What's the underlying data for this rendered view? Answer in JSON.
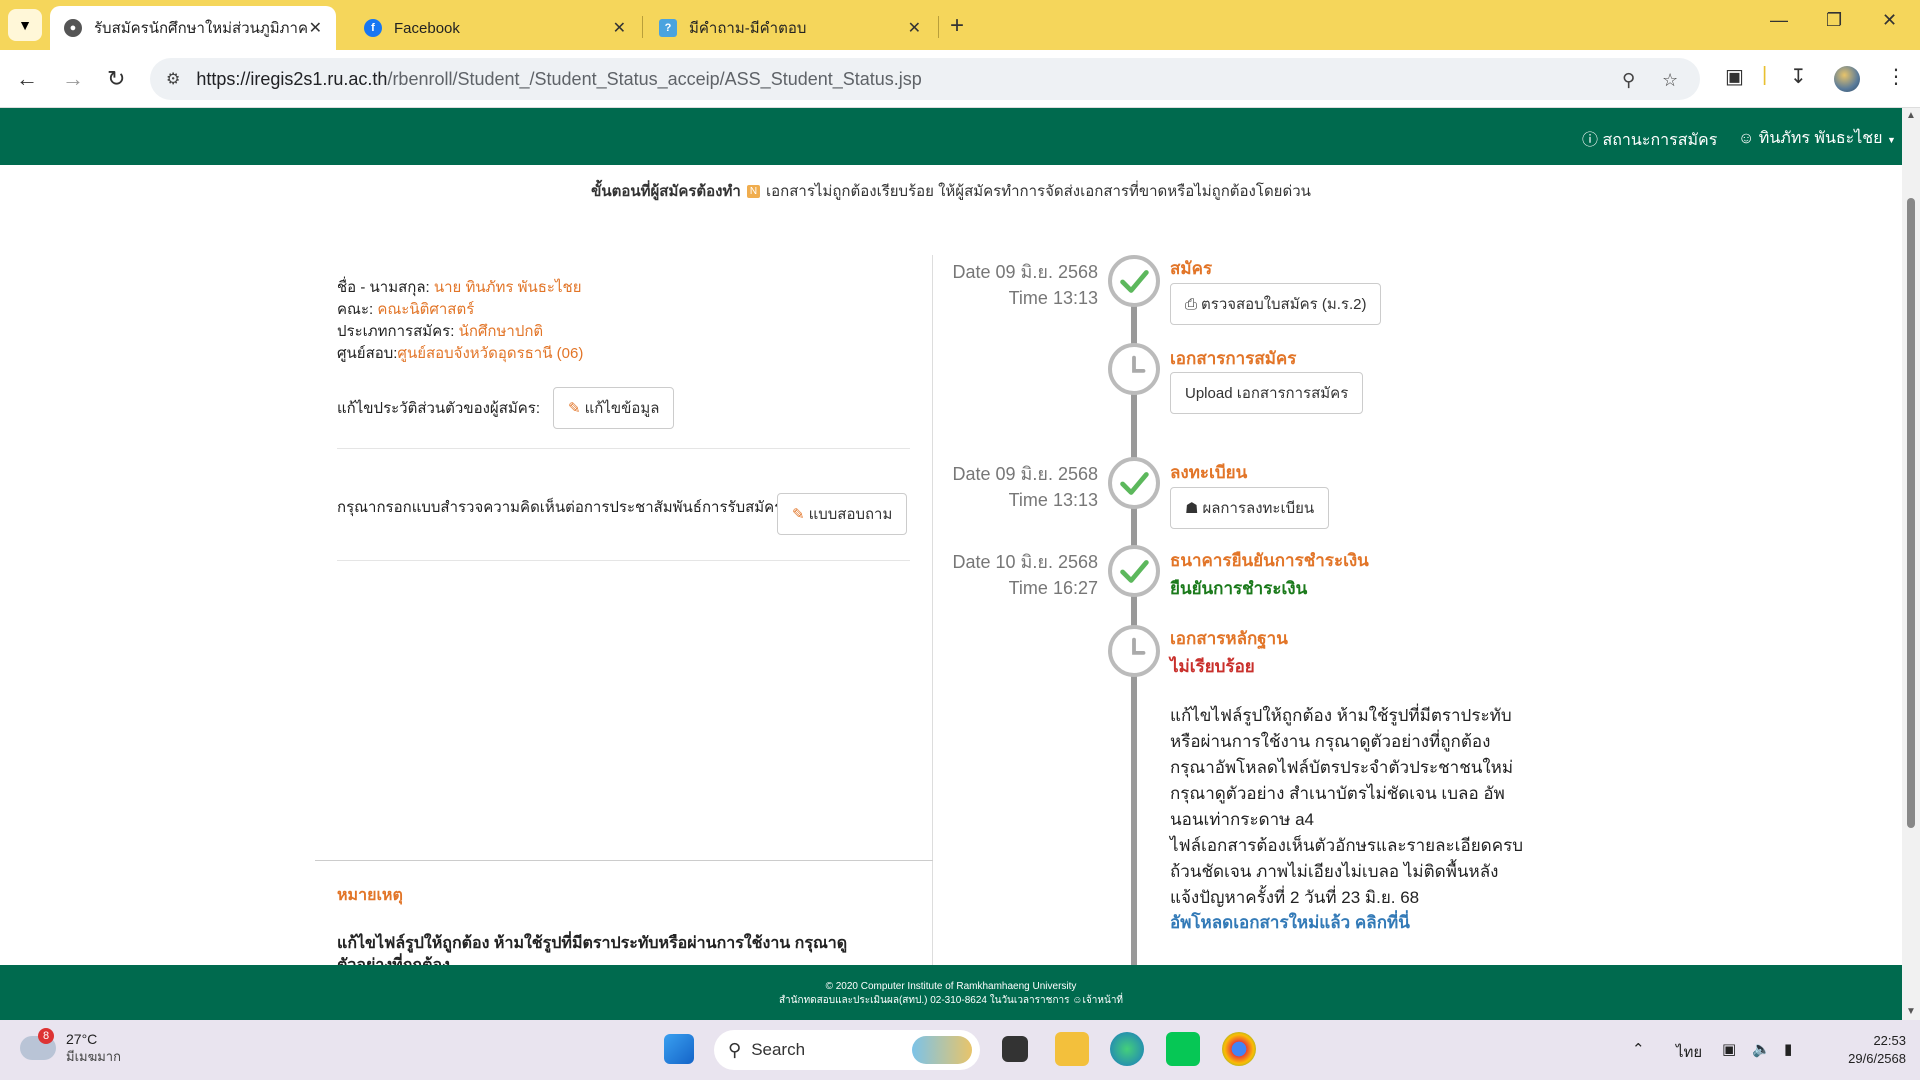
{
  "browser": {
    "tabs": [
      {
        "title": "รับสมัครนักศึกษาใหม่ส่วนภูมิภาค",
        "active": true
      },
      {
        "title": "Facebook",
        "active": false
      },
      {
        "title": "มีคำถาม-มีคำตอบ",
        "active": false
      }
    ],
    "url_host": "https://iregis2s1.ru.ac.th",
    "url_path": "/rbenroll/Student_/Student_Status_acceip/ASS_Student_Status.jsp"
  },
  "nav": {
    "status_label": "สถานะการสมัคร",
    "user_label": "ทินภัทร พันธะไชย"
  },
  "notice": {
    "lead": "ขั้นตอนที่ผู้สมัครต้องทำ",
    "badge": "N",
    "text": "เอกสารไม่ถูกต้องเรียบร้อย ให้ผู้สมัครทำการจัดส่งเอกสารที่ขาดหรือไม่ถูกต้องโดยด่วน"
  },
  "applicant": {
    "name_label": "ชื่อ - นามสกุล:",
    "name_value": "นาย ทินภัทร พันธะไชย",
    "faculty_label": "คณะ:",
    "faculty_value": "คณะนิติศาสตร์",
    "type_label": "ประเภทการสมัคร:",
    "type_value": "นักศึกษาปกติ",
    "center_label": "ศูนย์สอบ:",
    "center_value": "ศูนย์สอบจังหวัดอุดรธานี (06)",
    "edit_label": "แก้ไขประวัติส่วนตัวของผู้สมัคร:",
    "edit_button": "แก้ไขข้อมูล",
    "survey_label": "กรุณากรอกแบบสำรวจความคิดเห็นต่อการประชาสัมพันธ์การรับสมัคร",
    "survey_button": "แบบสอบถาม"
  },
  "remark": {
    "title": "หมายเหตุ",
    "body": "แก้ไขไฟล์รูปให้ถูกต้อง ห้ามใช้รูปที่มีตราประทับหรือผ่านการใช้งาน กรุณาดูตัวอย่างที่ถูกต้อง"
  },
  "timeline": {
    "apply": {
      "date": "Date 09 มิ.ย. 2568",
      "time": "Time 13:13",
      "title": "สมัคร",
      "button": "ตรวจสอบใบสมัคร (ม.ร.2)",
      "status": "done"
    },
    "docs": {
      "title": "เอกสารการสมัคร",
      "button": "Upload เอกสารการสมัคร",
      "status": "pending"
    },
    "register": {
      "date": "Date 09 มิ.ย. 2568",
      "time": "Time 13:13",
      "title": "ลงทะเบียน",
      "button": "ผลการลงทะเบียน",
      "status": "done"
    },
    "payment": {
      "date": "Date 10 มิ.ย. 2568",
      "time": "Time 16:27",
      "title": "ธนาคารยืนยันการชำระเงิน",
      "state": "ยืนยันการชำระเงิน",
      "status": "done"
    },
    "evidence": {
      "title": "เอกสารหลักฐาน",
      "state": "ไม่เรียบร้อย",
      "status": "pending",
      "desc_lines": [
        "แก้ไขไฟล์รูปให้ถูกต้อง ห้ามใช้รูปที่มีตราประทับ",
        "หรือผ่านการใช้งาน กรุณาดูตัวอย่างที่ถูกต้อง",
        "กรุณาอัพโหลดไฟล์บัตรประจำตัวประชาชนใหม่",
        "กรุณาดูตัวอย่าง สำเนาบัตรไม่ชัดเจน เบลอ อัพ",
        "นอนเท่ากระดาษ a4",
        "ไฟล์เอกสารต้องเห็นตัวอักษรและรายละเอียดครบ",
        "ถ้วนชัดเจน ภาพไม่เอียงไม่เบลอ ไม่ติดพื้นหลัง",
        "แจ้งปัญหาครั้งที่ 2 วันที่ 23 มิ.ย. 68"
      ],
      "link": "อัพโหลดเอกสารใหม่แล้ว คลิกที่นี่"
    }
  },
  "footer": {
    "line1": "© 2020 Computer Institute of Ramkhamhaeng University",
    "line2": "สำนักทดสอบและประเมินผล(สทป.) 02-310-8624 ในวันเวลาราชการ",
    "staff": "เจ้าหน้าที่"
  },
  "taskbar": {
    "temp": "27°C",
    "weather": "มีเมฆมาก",
    "weather_badge": "8",
    "search_placeholder": "Search",
    "lang": "ไทย",
    "time": "22:53",
    "date": "29/6/2568"
  },
  "colors": {
    "brand_green": "#006a4e",
    "accent_orange": "#e27528",
    "ok_green": "#5cb85c"
  }
}
